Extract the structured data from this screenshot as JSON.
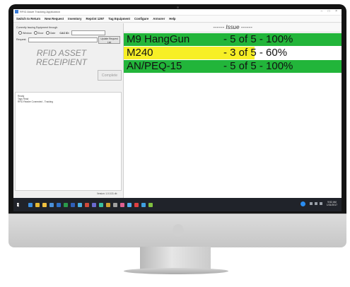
{
  "window": {
    "title": "RFID Asset Tracking Application",
    "controls": "– □ ×"
  },
  "menu": [
    "Switch to Return",
    "New Request",
    "Inventory",
    "Reprint 1297",
    "Tag Equipment",
    "Configure",
    "Armorer",
    "Help"
  ],
  "left": {
    "mode_label": "Currently Issuing Equipment through",
    "radio_options": [
      "Window",
      "Door",
      "Gate"
    ],
    "cac_label": "CAC ID:",
    "cac_value": "",
    "request_label": "Request:",
    "request_value": "",
    "update_button": "Update Request List",
    "title_line1": "RFID ASSET",
    "title_line2": "RECEIPIENT",
    "complete_button": "Complete",
    "log": [
      "Ready",
      "Tags Read",
      "RFID Reader Connected - Tracking"
    ],
    "version": "Version: 1.0.0.31 db"
  },
  "issue": {
    "header": "------ Issue ------",
    "rows": [
      {
        "name": "M9 HangGun",
        "status": "- 5 of 5 - 100%",
        "progress": 1.0,
        "color": "#22b53a"
      },
      {
        "name": "M240",
        "status": "- 3 of 5 - 60%",
        "progress": 0.6,
        "color": "#f7ef26"
      },
      {
        "name": "AN/PEQ-15",
        "status": "- 5 of 5 - 100%",
        "progress": 1.0,
        "color": "#22b53a"
      }
    ]
  },
  "taskbar": {
    "apps": [
      {
        "icon": "edge-icon",
        "color": "#3b8ee0"
      },
      {
        "icon": "chrome-icon",
        "color": "#e8b931"
      },
      {
        "icon": "explorer-icon",
        "color": "#f0c040"
      },
      {
        "icon": "store-icon",
        "color": "#4a90d9"
      },
      {
        "icon": "mail-icon",
        "color": "#2e6fc7"
      },
      {
        "icon": "excel-icon",
        "color": "#2a9a4a"
      },
      {
        "icon": "word-icon",
        "color": "#2f5fba"
      },
      {
        "icon": "app-icon",
        "color": "#4ab0e0"
      },
      {
        "icon": "app-icon",
        "color": "#d04a3a"
      },
      {
        "icon": "app-icon",
        "color": "#6a6ad0"
      },
      {
        "icon": "app-icon",
        "color": "#3ac0a0"
      },
      {
        "icon": "app-icon",
        "color": "#d0a030"
      },
      {
        "icon": "app-icon",
        "color": "#a0a0a0"
      },
      {
        "icon": "app-icon",
        "color": "#e06090"
      },
      {
        "icon": "app-icon",
        "color": "#50b0f0"
      },
      {
        "icon": "app-icon",
        "color": "#e04040"
      },
      {
        "icon": "app-icon",
        "color": "#40a0e0"
      },
      {
        "icon": "app-icon",
        "color": "#80c040"
      }
    ],
    "time": "9:52 AM",
    "date": "1/31/2017"
  }
}
